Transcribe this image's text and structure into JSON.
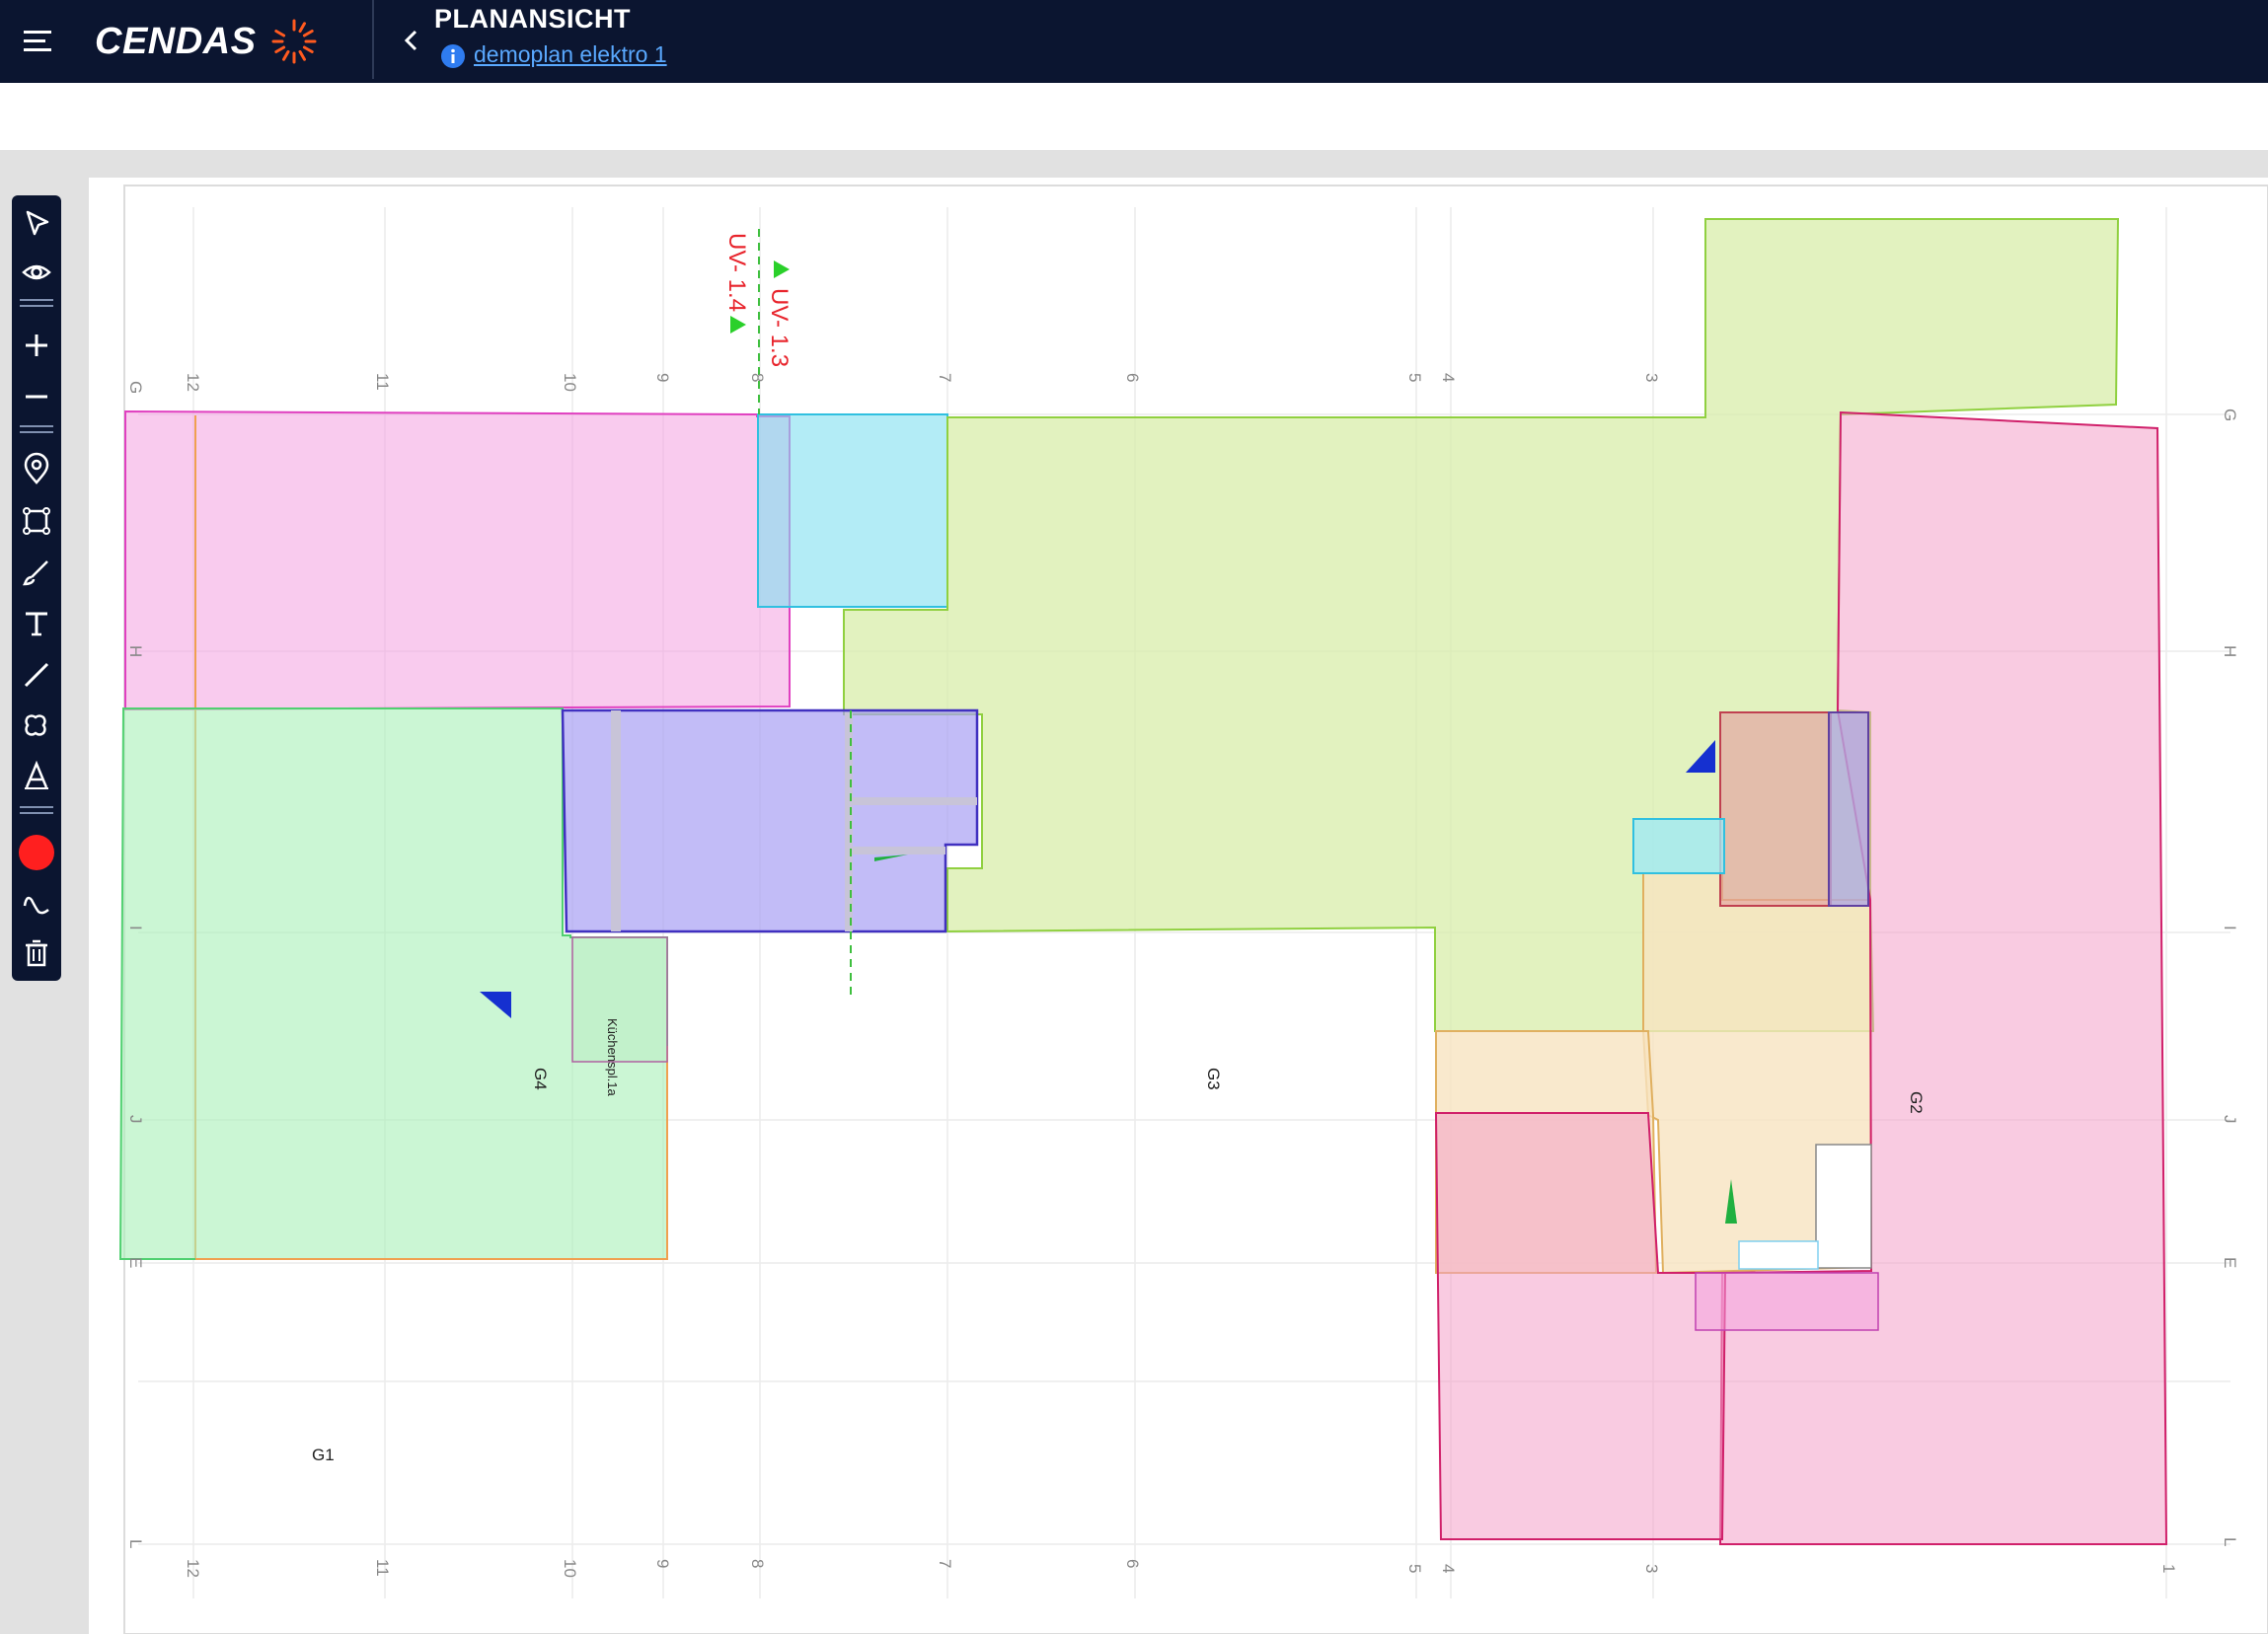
{
  "header": {
    "logo_text": "CENDAS",
    "title": "PLANANSICHT",
    "plan_link": "demoplan elektro 1"
  },
  "toolbar": {
    "tools": [
      "select-tool",
      "visibility-tool",
      "zoom-in-tool",
      "zoom-out-tool",
      "pin-tool",
      "area-tool",
      "freehand-tool",
      "text-tool",
      "line-tool",
      "cloud-tool",
      "measure-tool",
      "color-picker",
      "signature-tool",
      "delete-tool"
    ],
    "active_color": "#ff1f1f"
  },
  "plan": {
    "grid_top": [
      "G",
      "12",
      "11",
      "10",
      "9",
      "8",
      "7",
      "6",
      "5",
      "4",
      "3"
    ],
    "grid_bottom": [
      "L",
      "12",
      "11",
      "10",
      "9",
      "8",
      "7",
      "6",
      "5",
      "4",
      "3",
      "1"
    ],
    "grid_left": [
      "H",
      "I",
      "J",
      "E"
    ],
    "grid_right": [
      "G",
      "H",
      "I",
      "J",
      "E",
      "L"
    ],
    "zones": [
      "G1",
      "G2",
      "G3",
      "G4"
    ],
    "labels": {
      "uv_13": "UV- 1.3",
      "uv_14": "UV- 1.4",
      "kuechen": "Küchenspl.1a"
    },
    "colors": {
      "pink_zone": "#f4a0e0",
      "green_zone": "#a8f0b8",
      "cyan_zone": "#80e0f0",
      "lime_zone": "#d8eeaa",
      "violet_zone": "#a8a0f4",
      "rose_zone": "#f4a0c8",
      "peach_zone": "#f8e4c0"
    }
  }
}
